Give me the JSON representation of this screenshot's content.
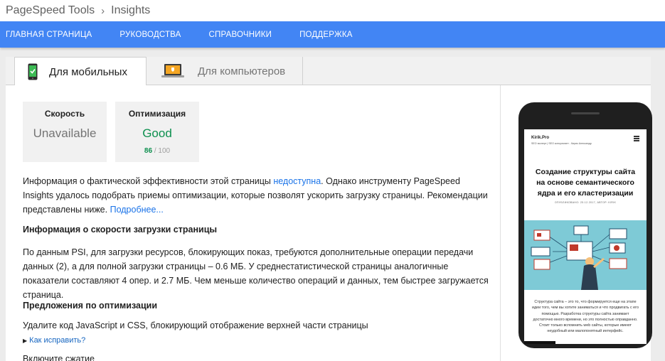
{
  "breadcrumb": {
    "app": "PageSpeed Tools",
    "separator": "›",
    "page": "Insights"
  },
  "nav": {
    "items": [
      "ГЛАВНАЯ СТРАНИЦА",
      "РУКОВОДСТВА",
      "СПРАВОЧНИКИ",
      "ПОДДЕРЖКА"
    ]
  },
  "tabs": {
    "mobile": "Для мобильных",
    "desktop": "Для компьютеров"
  },
  "scores": {
    "speed": {
      "label": "Скорость",
      "value": "Unavailable"
    },
    "optimization": {
      "label": "Оптимизация",
      "value": "Good",
      "score": "86",
      "max": "/ 100"
    }
  },
  "intro": {
    "part1": "Информация о фактической эффективности этой страницы ",
    "link1": "недоступна",
    "part2": ". Однако инструменту PageSpeed Insights удалось подобрать приемы оптимизации, которые позволят ускорить загрузку страницы. Рекомендации представлены ниже. ",
    "link2": "Подробнее..."
  },
  "speed_section": {
    "heading": "Информация о скорости загрузки страницы",
    "text": "По данным PSI, для загрузки ресурсов, блокирующих показ, требуются дополнительные операции передачи данных (2), а для полной загрузки страницы – 0.6 МБ. У среднестатистической страницы аналогичные показатели составляют 4 опер. и 2.7 МБ. Чем меньше количество операций и данных, тем быстрее загружается страница."
  },
  "opt_section": {
    "heading": "Предложения по оптимизации",
    "rules": [
      "Удалите код JavaScript и CSS, блокирующий отображение верхней части страницы",
      "Включите сжатие"
    ],
    "fix_link": "Как исправить?"
  },
  "preview": {
    "site_name": "Kirik.Pro",
    "site_sub": "SEO эксперт | SEO консультант - Кирик Александр",
    "title": "Создание структуры сайта на основе семантического ядра и его кластеризации",
    "meta": "ОПУБЛИКОВАНО: 25.12.2017, АВТОР: KIRIK",
    "excerpt": "Структура сайта – это то, что формируется еще на этапе идеи того, чем вы хотите заниматься и что продвигать с его помощью. Разработка структуры сайта занимает достаточно много времени, но это полностью оправданно. Стоит только вспомнить web сайты, которые имеют неудобный или малопонятный интерфейс."
  },
  "colors": {
    "accent": "#4285f4",
    "good": "#0d904f",
    "link": "#1a73e8"
  },
  "icons": {
    "mobile_tab": "smartphone-icon",
    "desktop_tab": "laptop-icon",
    "preview_menu": "hamburger-menu-icon"
  }
}
